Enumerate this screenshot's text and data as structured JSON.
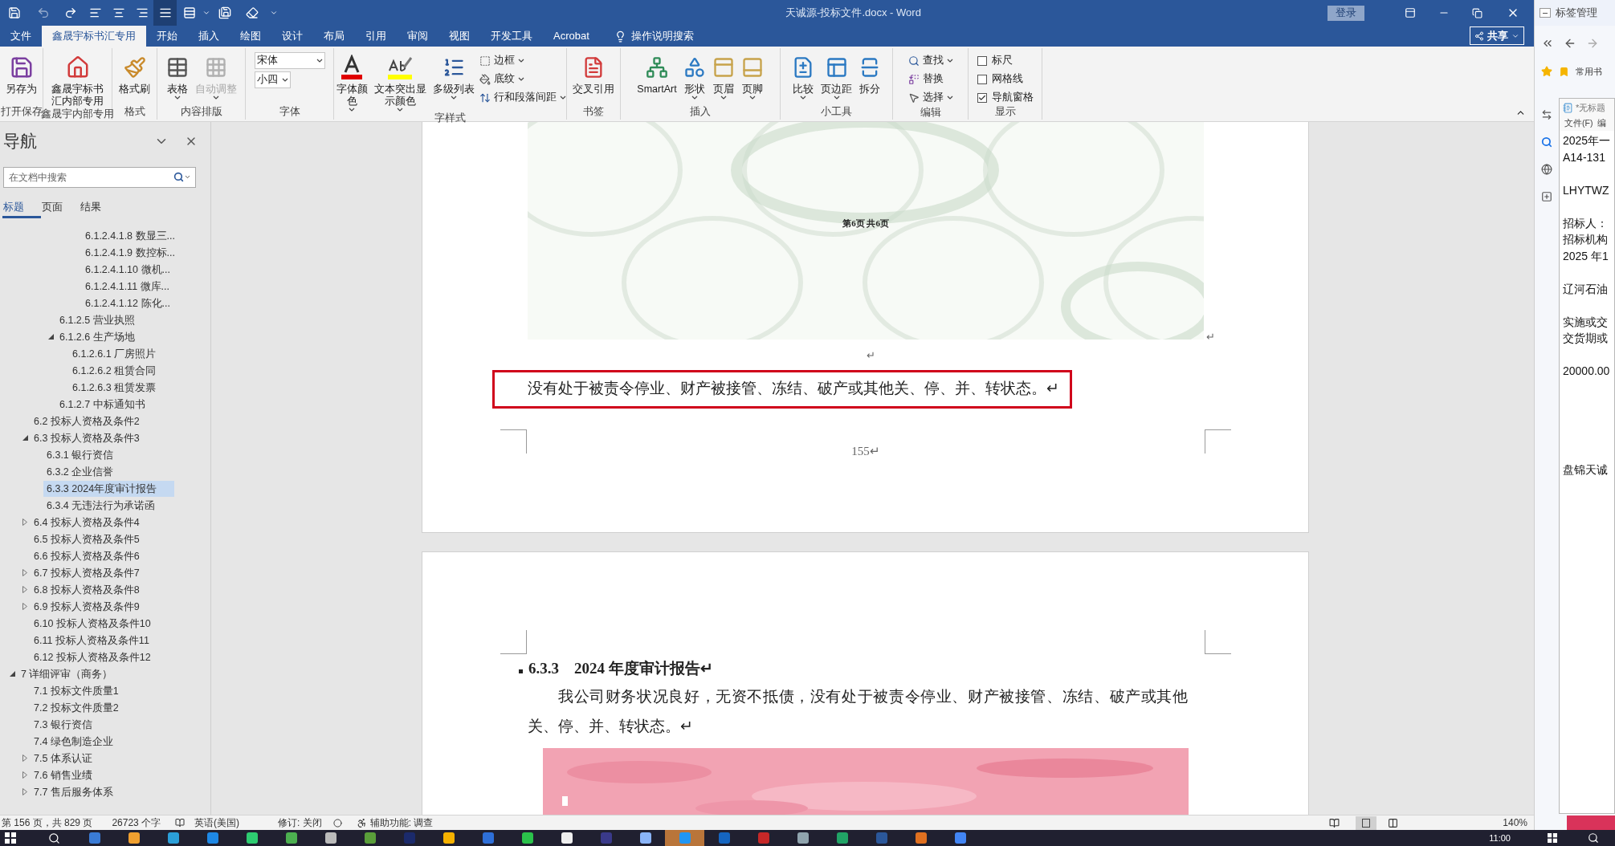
{
  "window": {
    "title": "天诚源-投标文件.docx - Word",
    "login": "登录"
  },
  "quick_access_alignment": [
    {
      "selected": false
    },
    {
      "selected": false
    },
    {
      "selected": false
    },
    {
      "selected": true
    }
  ],
  "ribbon_tabs": [
    {
      "label": "文件",
      "selected": false
    },
    {
      "label": "鑫晟宇标书汇专用",
      "selected": true
    },
    {
      "label": "开始",
      "selected": false
    },
    {
      "label": "插入",
      "selected": false
    },
    {
      "label": "绘图",
      "selected": false
    },
    {
      "label": "设计",
      "selected": false
    },
    {
      "label": "布局",
      "selected": false
    },
    {
      "label": "引用",
      "selected": false
    },
    {
      "label": "审阅",
      "selected": false
    },
    {
      "label": "视图",
      "selected": false
    },
    {
      "label": "开发工具",
      "selected": false
    },
    {
      "label": "Acrobat",
      "selected": false
    }
  ],
  "tell_me": "操作说明搜索",
  "share": "共享",
  "ribbon_groups": [
    {
      "label": "打开保存",
      "items": [
        {
          "kind": "large",
          "label": "另存为",
          "dropdown": false,
          "disabled": false
        }
      ]
    },
    {
      "label": "鑫晟宇内部专用",
      "items": [
        {
          "kind": "large",
          "lines": [
            "鑫晟宇标书",
            "汇内部专用"
          ],
          "dropdown": false,
          "disabled": false
        }
      ]
    },
    {
      "label": "格式",
      "items": [
        {
          "kind": "large",
          "label": "格式刷",
          "dropdown": false,
          "disabled": false
        }
      ]
    },
    {
      "label": "内容排版",
      "items": [
        {
          "kind": "large",
          "label": "表格",
          "dropdown": true,
          "disabled": false
        },
        {
          "kind": "large",
          "label": "自动调整",
          "dropdown": true,
          "disabled": true
        }
      ]
    },
    {
      "label": "字体",
      "items": [
        {
          "kind": "combo",
          "value": "宋体"
        },
        {
          "kind": "combo",
          "value": "小四"
        }
      ]
    },
    {
      "label": "字样式",
      "items": [
        {
          "kind": "large",
          "lines": [
            "字体颜",
            "色"
          ],
          "dropdown": true,
          "disabled": false
        },
        {
          "kind": "large",
          "lines": [
            "文本突出显",
            "示颜色"
          ],
          "dropdown": true,
          "disabled": false
        },
        {
          "kind": "large",
          "label": "多级列表",
          "dropdown": true,
          "disabled": false
        },
        {
          "kind": "small",
          "label": "边框",
          "dropdown": true
        },
        {
          "kind": "small",
          "label": "底纹",
          "dropdown": true
        },
        {
          "kind": "small",
          "label": "行和段落间距",
          "dropdown": true
        }
      ]
    },
    {
      "label": "书签",
      "items": [
        {
          "kind": "large",
          "label": "交叉引用",
          "dropdown": false,
          "disabled": false
        }
      ]
    },
    {
      "label": "插入",
      "items": [
        {
          "kind": "large",
          "label": "SmartArt",
          "dropdown": false,
          "disabled": false
        },
        {
          "kind": "large",
          "label": "形状",
          "dropdown": true,
          "disabled": false
        },
        {
          "kind": "large",
          "label": "页眉",
          "dropdown": true,
          "disabled": false
        },
        {
          "kind": "large",
          "label": "页脚",
          "dropdown": true,
          "disabled": false
        }
      ]
    },
    {
      "label": "小工具",
      "items": [
        {
          "kind": "large",
          "label": "比较",
          "dropdown": true,
          "disabled": false
        },
        {
          "kind": "large",
          "label": "页边距",
          "dropdown": true,
          "disabled": false
        },
        {
          "kind": "large",
          "label": "拆分",
          "dropdown": false,
          "disabled": false
        }
      ]
    },
    {
      "label": "编辑",
      "items": [
        {
          "kind": "small",
          "label": "查找",
          "dropdown": true
        },
        {
          "kind": "small",
          "label": "替换",
          "dropdown": false
        },
        {
          "kind": "small",
          "label": "选择",
          "dropdown": true
        }
      ]
    },
    {
      "label": "显示",
      "items": [
        {
          "kind": "checkbox",
          "label": "标尺",
          "checked": false
        },
        {
          "kind": "checkbox",
          "label": "网格线",
          "checked": false
        },
        {
          "kind": "checkbox",
          "label": "导航窗格",
          "checked": true
        }
      ]
    }
  ],
  "navigation": {
    "title": "导航",
    "search_placeholder": "在文档中搜索",
    "tabs": [
      {
        "label": "标题",
        "selected": true
      },
      {
        "label": "页面",
        "selected": false
      },
      {
        "label": "结果",
        "selected": false
      }
    ],
    "tree": [
      {
        "children": [
          {
            "children": [
              {
                "children": [
                  {
                    "children": [
                      {
                        "children": [
                          {
                            "label": "6.1.2.4.1.8 数显三...",
                            "selected": false
                          },
                          {
                            "label": "6.1.2.4.1.9 数控标...",
                            "selected": false
                          },
                          {
                            "label": "6.1.2.4.1.10 微机...",
                            "selected": false
                          },
                          {
                            "label": "6.1.2.4.1.11 微库...",
                            "selected": false
                          },
                          {
                            "label": "6.1.2.4.1.12 陈化...",
                            "selected": false
                          }
                        ]
                      }
                    ]
                  },
                  {
                    "label": "6.1.2.5 营业执照",
                    "selected": false
                  },
                  {
                    "label": "6.1.2.6 生产场地",
                    "selected": false,
                    "expanded": true,
                    "children": [
                      {
                        "label": "6.1.2.6.1 厂房照片",
                        "selected": false
                      },
                      {
                        "label": "6.1.2.6.2 租赁合同",
                        "selected": false
                      },
                      {
                        "label": "6.1.2.6.3 租赁发票",
                        "selected": false
                      }
                    ]
                  },
                  {
                    "label": "6.1.2.7 中标通知书",
                    "selected": false
                  }
                ]
              }
            ]
          },
          {
            "label": "6.2 投标人资格及条件2",
            "selected": false
          },
          {
            "label": "6.3 投标人资格及条件3",
            "selected": false,
            "expanded": true,
            "children": [
              {
                "label": "6.3.1 银行资信",
                "selected": false
              },
              {
                "label": "6.3.2 企业信誉",
                "selected": false
              },
              {
                "label": "6.3.3 2024年度审计报告",
                "selected": true
              },
              {
                "label": "6.3.4 无违法行为承诺函",
                "selected": false
              }
            ]
          },
          {
            "label": "6.4 投标人资格及条件4",
            "selected": false,
            "expanded": false
          },
          {
            "label": "6.5 投标人资格及条件5",
            "selected": false
          },
          {
            "label": "6.6 投标人资格及条件6",
            "selected": false
          },
          {
            "label": "6.7 投标人资格及条件7",
            "selected": false,
            "expanded": false
          },
          {
            "label": "6.8 投标人资格及条件8",
            "selected": false,
            "expanded": false
          },
          {
            "label": "6.9 投标人资格及条件9",
            "selected": false,
            "expanded": false
          },
          {
            "label": "6.10 投标人资格及条件10",
            "selected": false
          },
          {
            "label": "6.11 投标人资格及条件11",
            "selected": false
          },
          {
            "label": "6.12 投标人资格及条件12",
            "selected": false
          }
        ]
      },
      {
        "label": "7 详细评审（商务）",
        "selected": false,
        "expanded": true,
        "children": [
          {
            "label": "7.1 投标文件质量1",
            "selected": false
          },
          {
            "label": "7.2 投标文件质量2",
            "selected": false
          },
          {
            "label": "7.3 银行资信",
            "selected": false
          },
          {
            "label": "7.4 绿色制造企业",
            "selected": false
          },
          {
            "label": "7.5 体系认证",
            "selected": false,
            "expanded": false
          },
          {
            "label": "7.6 销售业绩",
            "selected": false,
            "expanded": false
          },
          {
            "label": "7.7 售后服务体系",
            "selected": false,
            "expanded": false
          }
        ]
      }
    ]
  },
  "document": {
    "page1": {
      "scan_footer": "第6页  共6页",
      "scan_end_mark": "↵",
      "empty_paragraph": "↵",
      "highlighted_paragraph": "没有处于被责令停业、财产被接管、冻结、破产或其他关、停、并、转状态。↵",
      "page_number": "155↵"
    },
    "page2": {
      "heading": "6.3.3　2024 年度审计报告↵",
      "paragraph": "我公司财务状况良好，无资不抵债，没有处于被责令停业、财产被接管、冻结、破产或其他关、停、并、转状态。↵"
    }
  },
  "status_bar": {
    "items": [
      "第 156 页，共 829 页",
      "26723 个字",
      "英语(美国)",
      "修订: 关闭",
      "辅助功能: 调查"
    ],
    "zoom": "140%"
  },
  "side_panel": {
    "title": "标签管理",
    "bookmark": "常用书",
    "notepad": {
      "title": "*无标题",
      "menu": [
        "文件(F)",
        "编"
      ],
      "blocks": [
        {
          "kind": "near",
          "lines": [
            "2025年一",
            "A14-131"
          ]
        },
        {
          "kind": "near",
          "lines": [
            "LHYTWZ"
          ]
        },
        {
          "kind": "near",
          "lines": [
            "招标人：",
            "招标机构",
            "2025 年1"
          ]
        },
        {
          "kind": "near",
          "lines": [
            "辽河石油"
          ]
        },
        {
          "kind": "near",
          "lines": [
            "实施或交",
            "交货期或"
          ]
        },
        {
          "kind": "near",
          "lines": [
            "20000.00"
          ]
        },
        {
          "kind": "far",
          "lines": [
            "盘锦天诚"
          ]
        }
      ]
    }
  },
  "taskbar": {
    "apps": [
      {
        "selected": false
      },
      {
        "selected": false
      },
      {
        "selected": false
      },
      {
        "selected": false
      },
      {
        "selected": false
      },
      {
        "selected": false
      },
      {
        "selected": false
      },
      {
        "selected": false
      },
      {
        "selected": false
      },
      {
        "selected": false
      },
      {
        "selected": false
      },
      {
        "selected": false
      },
      {
        "selected": false
      },
      {
        "selected": false
      },
      {
        "selected": false
      },
      {
        "selected": true
      },
      {
        "selected": false
      },
      {
        "selected": false
      },
      {
        "selected": false
      },
      {
        "selected": false
      },
      {
        "selected": false
      },
      {
        "selected": false
      },
      {
        "selected": false
      }
    ],
    "time": "11:00"
  }
}
